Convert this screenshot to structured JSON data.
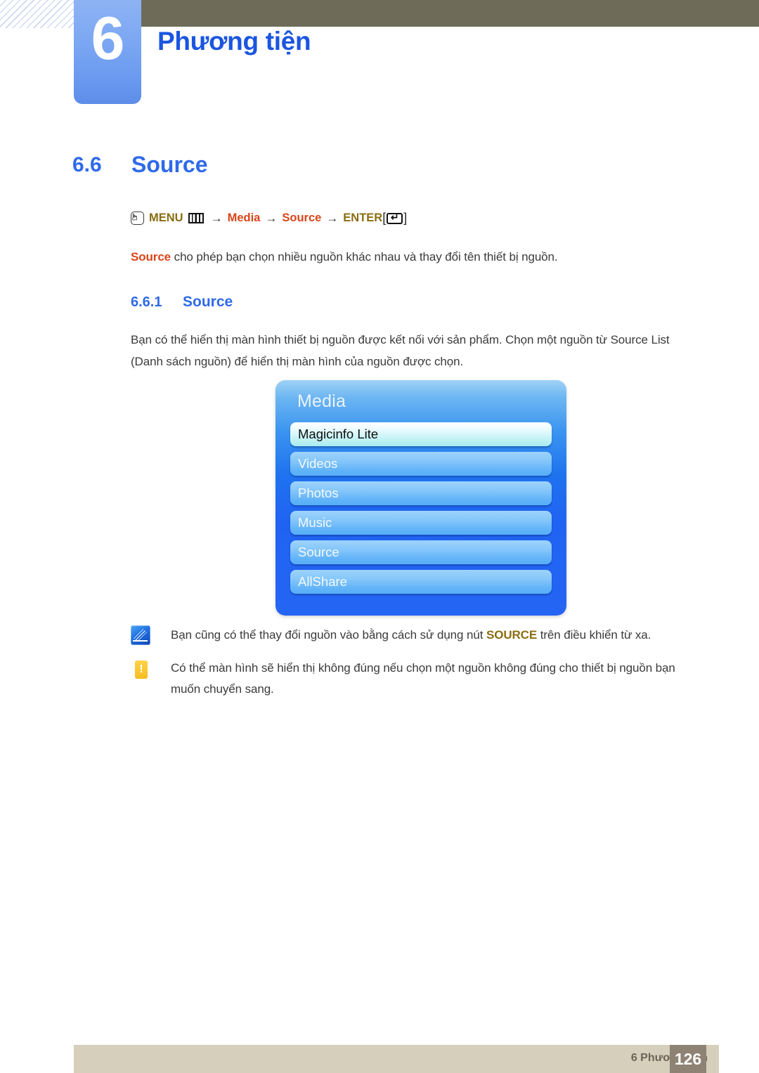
{
  "header": {
    "chapter_number": "6",
    "chapter_title": "Phương tiện"
  },
  "section": {
    "number": "6.6",
    "title": "Source"
  },
  "menu_path": {
    "hand_icon": "hand-press-icon",
    "menu_label": "MENU",
    "menu_icon": "menu-bars-icon",
    "arrow": "→",
    "item1": "Media",
    "item2": "Source",
    "enter_label": "ENTER",
    "bracket_open": "[",
    "bracket_close": "]",
    "enter_icon": "enter-key-icon"
  },
  "intro": {
    "bold_prefix": "Source",
    "rest": " cho phép bạn chọn nhiều nguồn khác nhau và thay đổi tên thiết bị nguồn."
  },
  "subsection": {
    "number": "6.6.1",
    "title": "Source",
    "paragraph": "Bạn có thể hiển thị màn hình thiết bị nguồn được kết nối với sản phẩm. Chọn một nguồn từ Source List (Danh sách nguồn) để hiển thị màn hình của nguồn được chọn."
  },
  "osd": {
    "title": "Media",
    "items": [
      {
        "label": "Magicinfo Lite",
        "selected": true
      },
      {
        "label": "Videos",
        "selected": false
      },
      {
        "label": "Photos",
        "selected": false
      },
      {
        "label": "Music",
        "selected": false
      },
      {
        "label": "Source",
        "selected": false
      },
      {
        "label": "AllShare",
        "selected": false
      }
    ]
  },
  "notes": [
    {
      "icon": "note-pen-icon",
      "text_before": "Bạn cũng có thể thay đổi nguồn vào bằng cách sử dụng nút ",
      "bold": "SOURCE",
      "text_after": " trên điều khiển từ xa."
    },
    {
      "icon": "caution-exclamation-icon",
      "text": "Có thể màn hình sẽ hiển thị không đúng nếu chọn một nguồn không đúng cho thiết bị nguồn bạn muốn chuyển sang."
    }
  ],
  "footer": {
    "label": "6 Phương tiện",
    "page": "126"
  },
  "colors": {
    "accent_blue": "#2f6ae8",
    "title_blue": "#1b55e0",
    "path_gold": "#8a6d12",
    "path_red": "#d9451a",
    "header_olive": "#6e6c58",
    "footer_beige": "#d6cfbc",
    "footer_page_brown": "#8e8274"
  }
}
